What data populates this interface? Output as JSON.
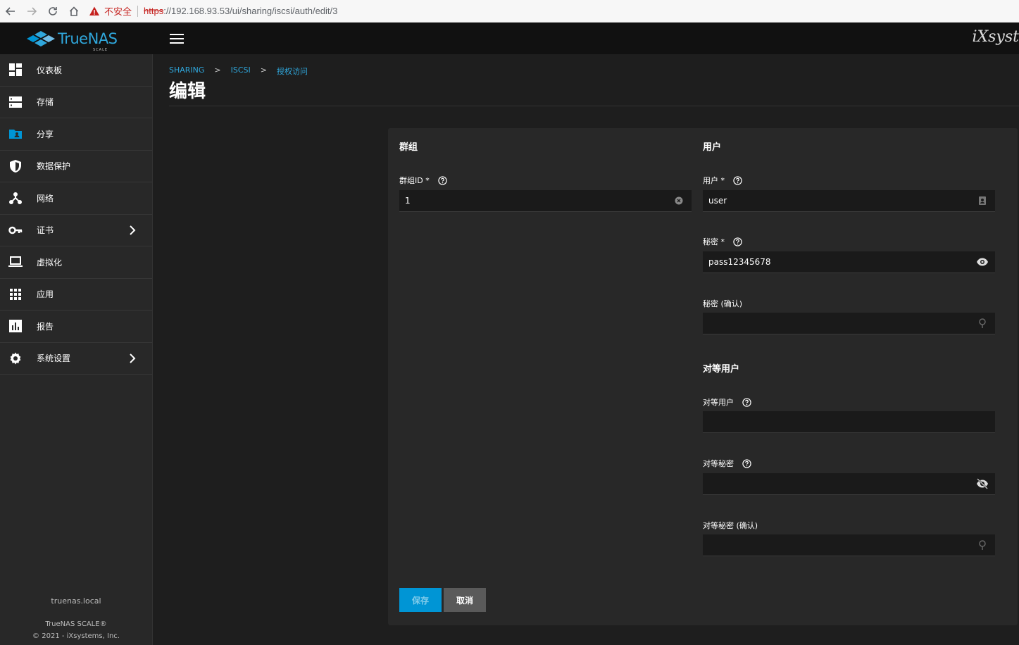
{
  "browser": {
    "warning_text": "不安全",
    "url_scheme": "https",
    "url_rest": "://192.168.93.53/ui/sharing/iscsi/auth/edit/3"
  },
  "app": {
    "logo_text": "TrueNAS",
    "logo_sub": "SCALE",
    "brand_right": "iXsyst",
    "accent": "#0095d5"
  },
  "sidebar": {
    "items": [
      {
        "label": "仪表板",
        "icon": "dashboard-icon"
      },
      {
        "label": "存储",
        "icon": "storage-icon"
      },
      {
        "label": "分享",
        "icon": "folder-shared-icon"
      },
      {
        "label": "数据保护",
        "icon": "shield-icon"
      },
      {
        "label": "网络",
        "icon": "network-icon"
      },
      {
        "label": "证书",
        "icon": "key-icon"
      },
      {
        "label": "虚拟化",
        "icon": "laptop-icon"
      },
      {
        "label": "应用",
        "icon": "apps-grid-icon"
      },
      {
        "label": "报告",
        "icon": "bar-chart-icon"
      },
      {
        "label": "系统设置",
        "icon": "gear-icon"
      }
    ],
    "hostname": "truenas.local",
    "version": "TrueNAS SCALE®",
    "copyright": "© 2021 - iXsystems, Inc."
  },
  "breadcrumb": [
    "SHARING",
    ">",
    "ISCSI",
    ">",
    "授权访问"
  ],
  "page_title": "编辑",
  "form": {
    "group_section": "群组",
    "group_id_label": "群组ID *",
    "group_id_value": "1",
    "user_section": "用户",
    "user_label": "用户 *",
    "user_value": "user",
    "secret_label": "秘密 *",
    "secret_value": "pass12345678",
    "secret_confirm_label": "秘密 (确认)",
    "secret_confirm_value": "",
    "peer_section": "对等用户",
    "peer_user_label": "对等用户",
    "peer_user_value": "",
    "peer_secret_label": "对等秘密",
    "peer_secret_value": "",
    "peer_secret_confirm_label": "对等秘密 (确认)",
    "peer_secret_confirm_value": ""
  },
  "buttons": {
    "save": "保存",
    "cancel": "取消"
  }
}
